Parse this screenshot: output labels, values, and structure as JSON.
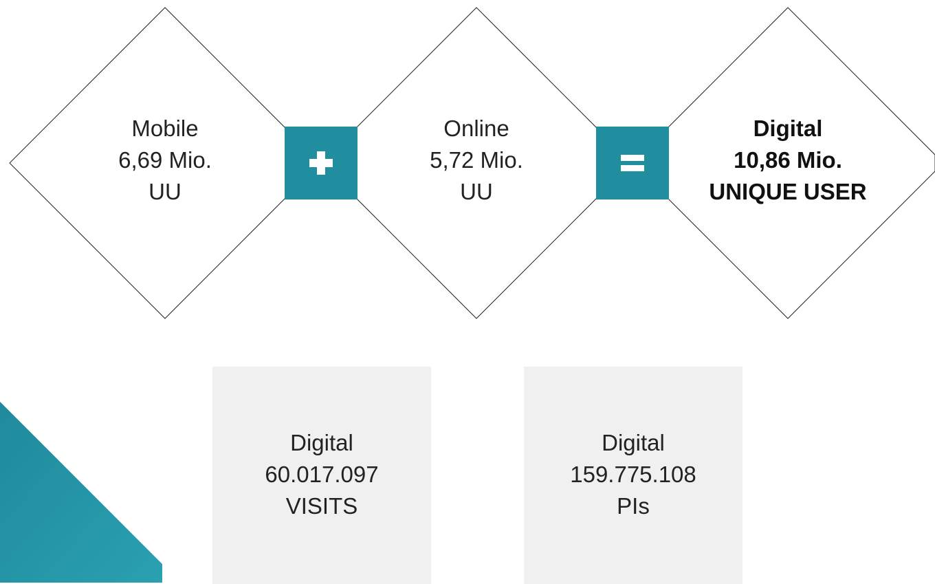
{
  "colors": {
    "accent": "#218ea0",
    "accent_dark": "#1f8a9c",
    "box_bg": "#f0f0f0",
    "line": "#222222"
  },
  "diamonds": [
    {
      "line1": "Mobile",
      "line2": "6,69 Mio.",
      "line3": "UU"
    },
    {
      "line1": "Online",
      "line2": "5,72 Mio.",
      "line3": "UU"
    },
    {
      "line1": "Digital",
      "line2": "10,86 Mio.",
      "line3": "UNIQUE USER"
    }
  ],
  "operators": {
    "plus": "plus-icon",
    "equals": "equals-icon"
  },
  "stats": [
    {
      "line1": "Digital",
      "line2": "60.017.097",
      "line3": "VISITS"
    },
    {
      "line1": "Digital",
      "line2": "159.775.108",
      "line3": "PIs"
    }
  ]
}
